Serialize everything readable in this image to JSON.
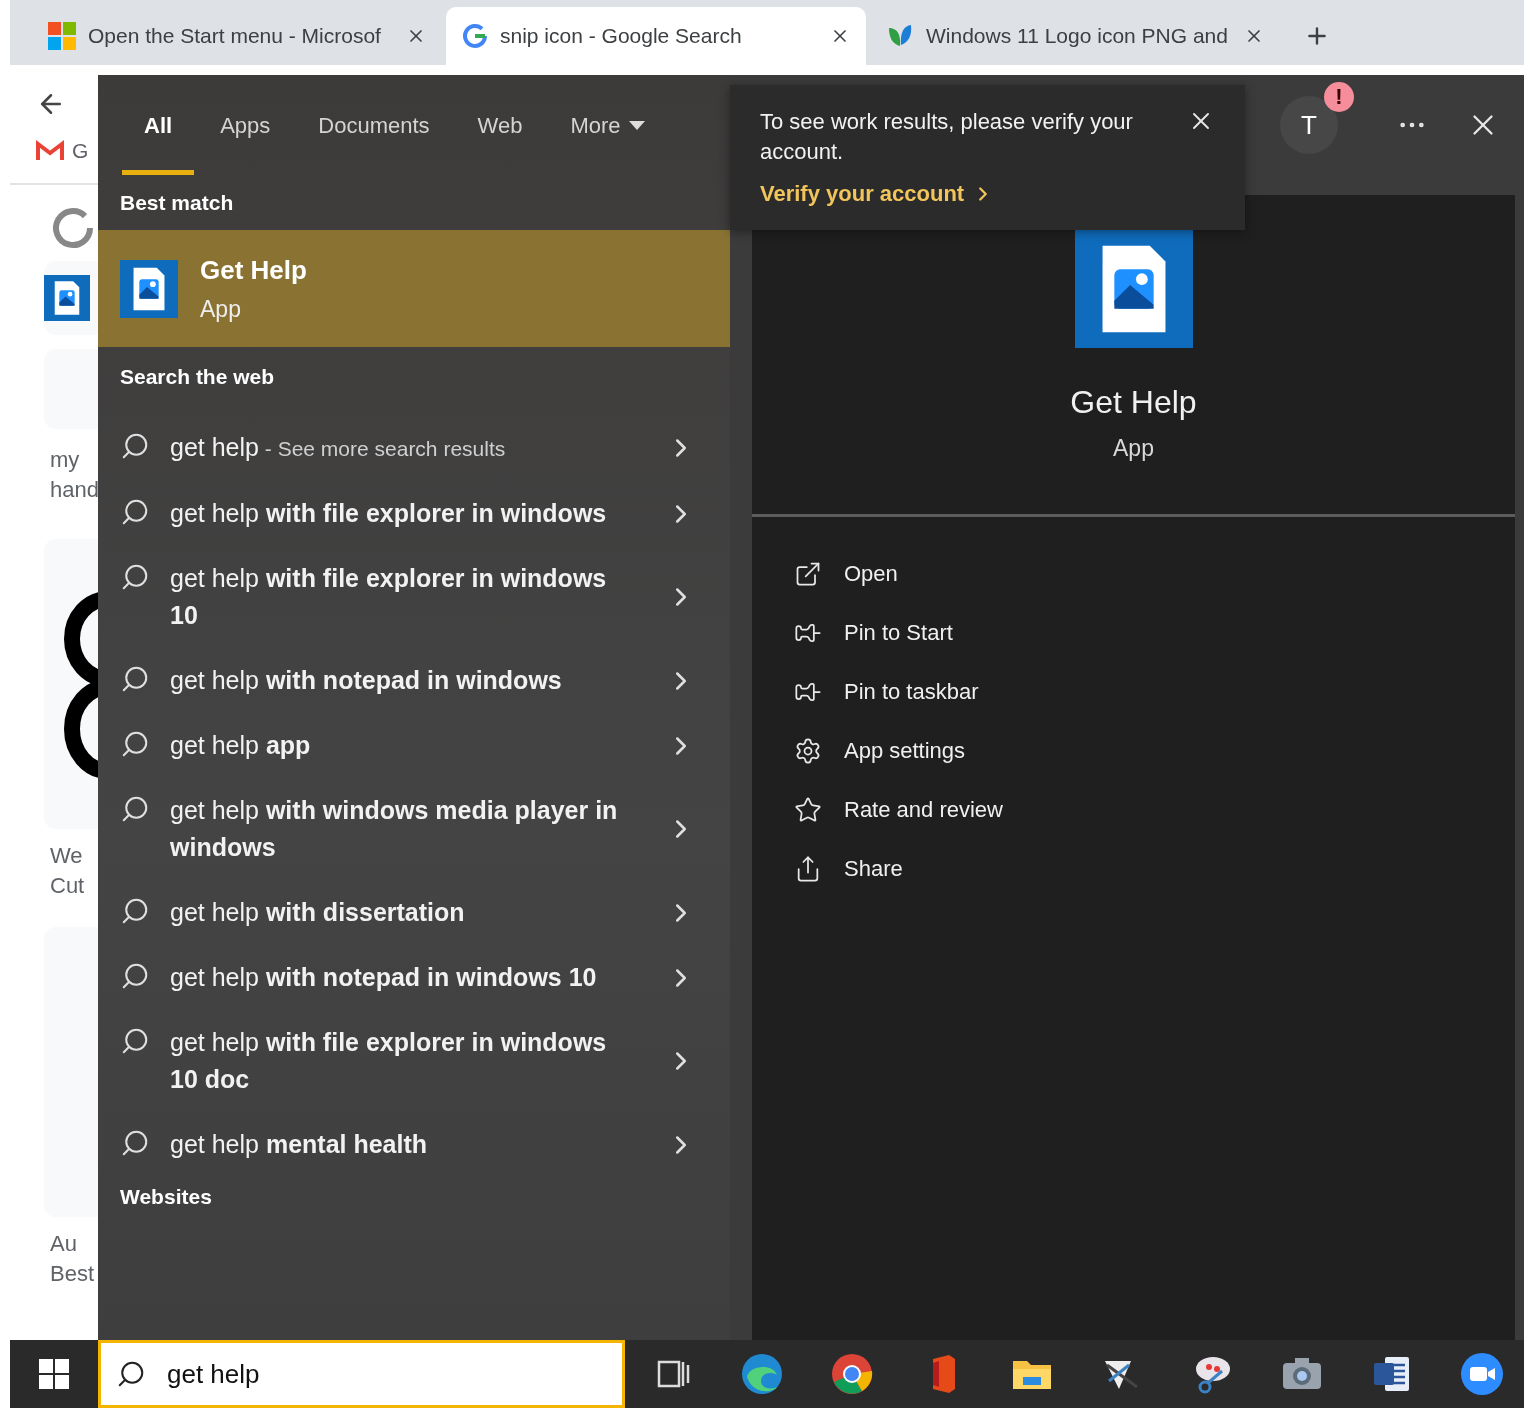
{
  "browser": {
    "tabs": [
      {
        "title": "Open the Start menu - Microsof",
        "selected": false,
        "kind": "grid"
      },
      {
        "title": "snip icon - Google Search",
        "selected": true,
        "kind": "google"
      },
      {
        "title": "Windows 11 Logo icon PNG and",
        "selected": false,
        "kind": "leaf"
      }
    ],
    "bookmark": "G",
    "page_fragments": [
      "my",
      "hand",
      "We",
      "Cut",
      "Au",
      "Best"
    ]
  },
  "search": {
    "filters": [
      {
        "label": "All",
        "selected": true,
        "kind": "tab"
      },
      {
        "label": "Apps",
        "selected": false,
        "kind": "tab"
      },
      {
        "label": "Documents",
        "selected": false,
        "kind": "tab"
      },
      {
        "label": "Web",
        "selected": false,
        "kind": "tab"
      },
      {
        "label": "More",
        "selected": false,
        "kind": "menu"
      }
    ],
    "best_match": {
      "header": "Best match",
      "title": "Get Help",
      "subtitle": "App",
      "selected": true
    },
    "web_header": "Search the web",
    "web_results": [
      {
        "text": "get help",
        "hint": "- See more search results"
      },
      {
        "text": "get help **with file explorer in windows**"
      },
      {
        "text": "get help **with file explorer in windows 10**"
      },
      {
        "text": "get help **with notepad in windows**"
      },
      {
        "text": "get help **app**"
      },
      {
        "text": "get help **with windows media player in windows**"
      },
      {
        "text": "get help **with dissertation**"
      },
      {
        "text": "get help **with notepad in windows 10**"
      },
      {
        "text": "get help **with file explorer in windows 10 doc**"
      },
      {
        "text": "get help **mental health**"
      }
    ],
    "websites_header": "Websites",
    "notice": {
      "text": "To see work results, please verify your account.",
      "link": "Verify your account"
    },
    "account": {
      "initial": "T",
      "alert": "!"
    },
    "preview": {
      "title": "Get Help",
      "subtitle": "App",
      "actions": [
        {
          "label": "Open",
          "kind": "open"
        },
        {
          "label": "Pin to Start",
          "kind": "pin"
        },
        {
          "label": "Pin to taskbar",
          "kind": "pin"
        },
        {
          "label": "App settings",
          "kind": "gear"
        },
        {
          "label": "Rate and review",
          "kind": "star"
        },
        {
          "label": "Share",
          "kind": "share"
        }
      ]
    }
  },
  "taskbar": {
    "search_value": "get help",
    "apps": [
      {
        "kind": "taskview"
      },
      {
        "kind": "edge"
      },
      {
        "kind": "chrome"
      },
      {
        "kind": "office"
      },
      {
        "kind": "explorer"
      },
      {
        "kind": "snip"
      },
      {
        "kind": "sketch"
      },
      {
        "kind": "camera"
      },
      {
        "kind": "word"
      },
      {
        "kind": "zoom"
      }
    ]
  }
}
